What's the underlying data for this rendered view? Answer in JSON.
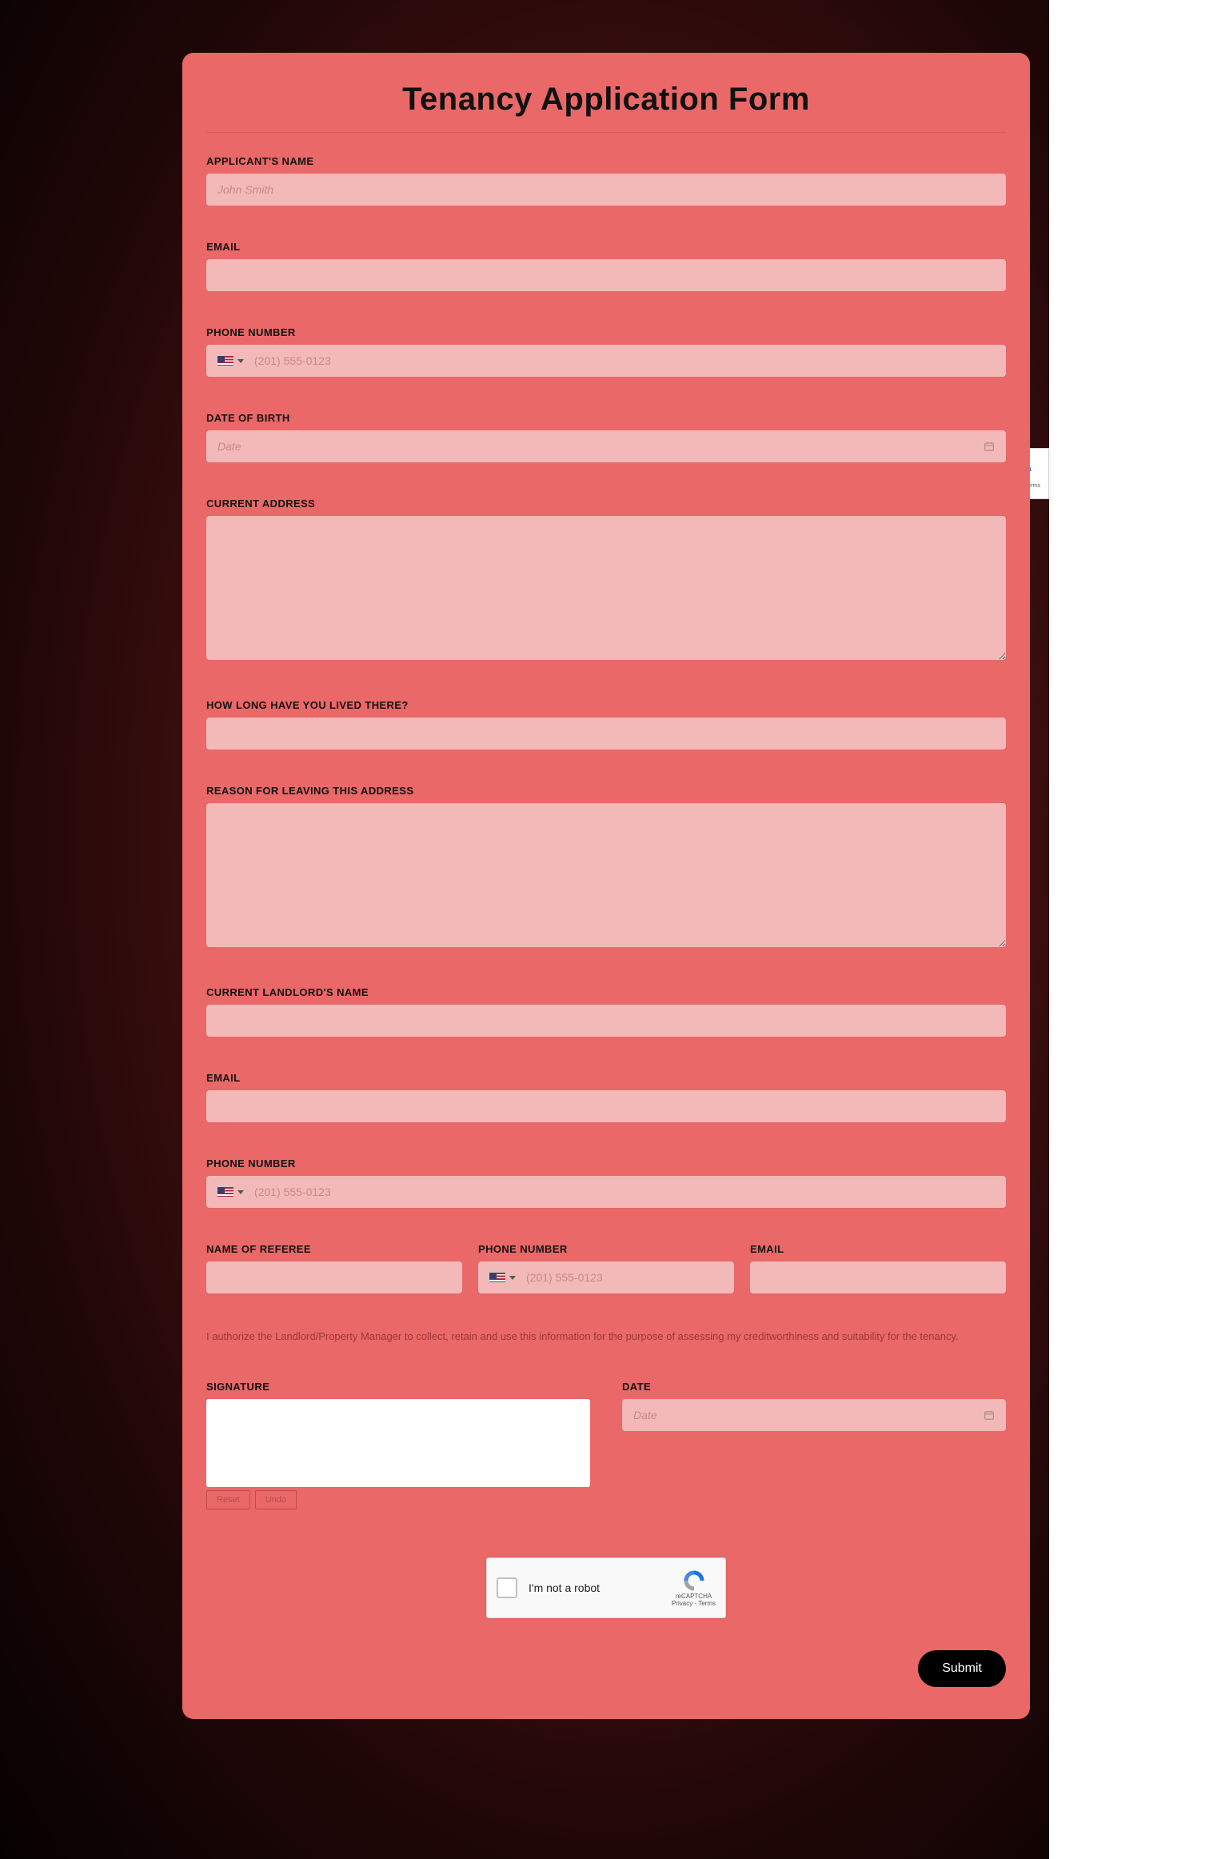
{
  "form": {
    "title": "Tenancy Application Form",
    "fields": {
      "applicant_name": {
        "label": "APPLICANT'S NAME",
        "placeholder": "John Smith",
        "value": ""
      },
      "email": {
        "label": "EMAIL",
        "value": ""
      },
      "phone": {
        "label": "PHONE NUMBER",
        "placeholder": "(201) 555-0123",
        "value": ""
      },
      "dob": {
        "label": "DATE OF BIRTH",
        "placeholder": "Date",
        "value": ""
      },
      "current_address": {
        "label": "CURRENT ADDRESS",
        "value": ""
      },
      "how_long": {
        "label": "HOW LONG HAVE YOU LIVED THERE?",
        "value": ""
      },
      "reason_leaving": {
        "label": "REASON FOR LEAVING THIS ADDRESS",
        "value": ""
      },
      "landlord_name": {
        "label": "CURRENT LANDLORD'S NAME",
        "value": ""
      },
      "landlord_email": {
        "label": "EMAIL",
        "value": ""
      },
      "landlord_phone": {
        "label": "PHONE NUMBER",
        "placeholder": "(201) 555-0123",
        "value": ""
      },
      "referee_name": {
        "label": "NAME OF REFEREE",
        "value": ""
      },
      "referee_phone": {
        "label": "PHONE NUMBER",
        "placeholder": "(201) 555-0123",
        "value": ""
      },
      "referee_email": {
        "label": "EMAIL",
        "value": ""
      },
      "authorization_text": "I authorize the Landlord/Property Manager to collect, retain and use this information for the purpose of assessing my creditworthiness and suitability for the tenancy.",
      "signature": {
        "label": "SIGNATURE"
      },
      "sig_reset": "Reset",
      "sig_undo": "Undo",
      "date": {
        "label": "DATE",
        "placeholder": "Date",
        "value": ""
      }
    },
    "captcha": {
      "label": "I'm not a robot",
      "brand": "reCAPTCHA",
      "sub": "Privacy - Terms"
    },
    "submit_label": "Submit"
  },
  "recaptcha_badge": {
    "sub": "Privacy - Terms"
  }
}
